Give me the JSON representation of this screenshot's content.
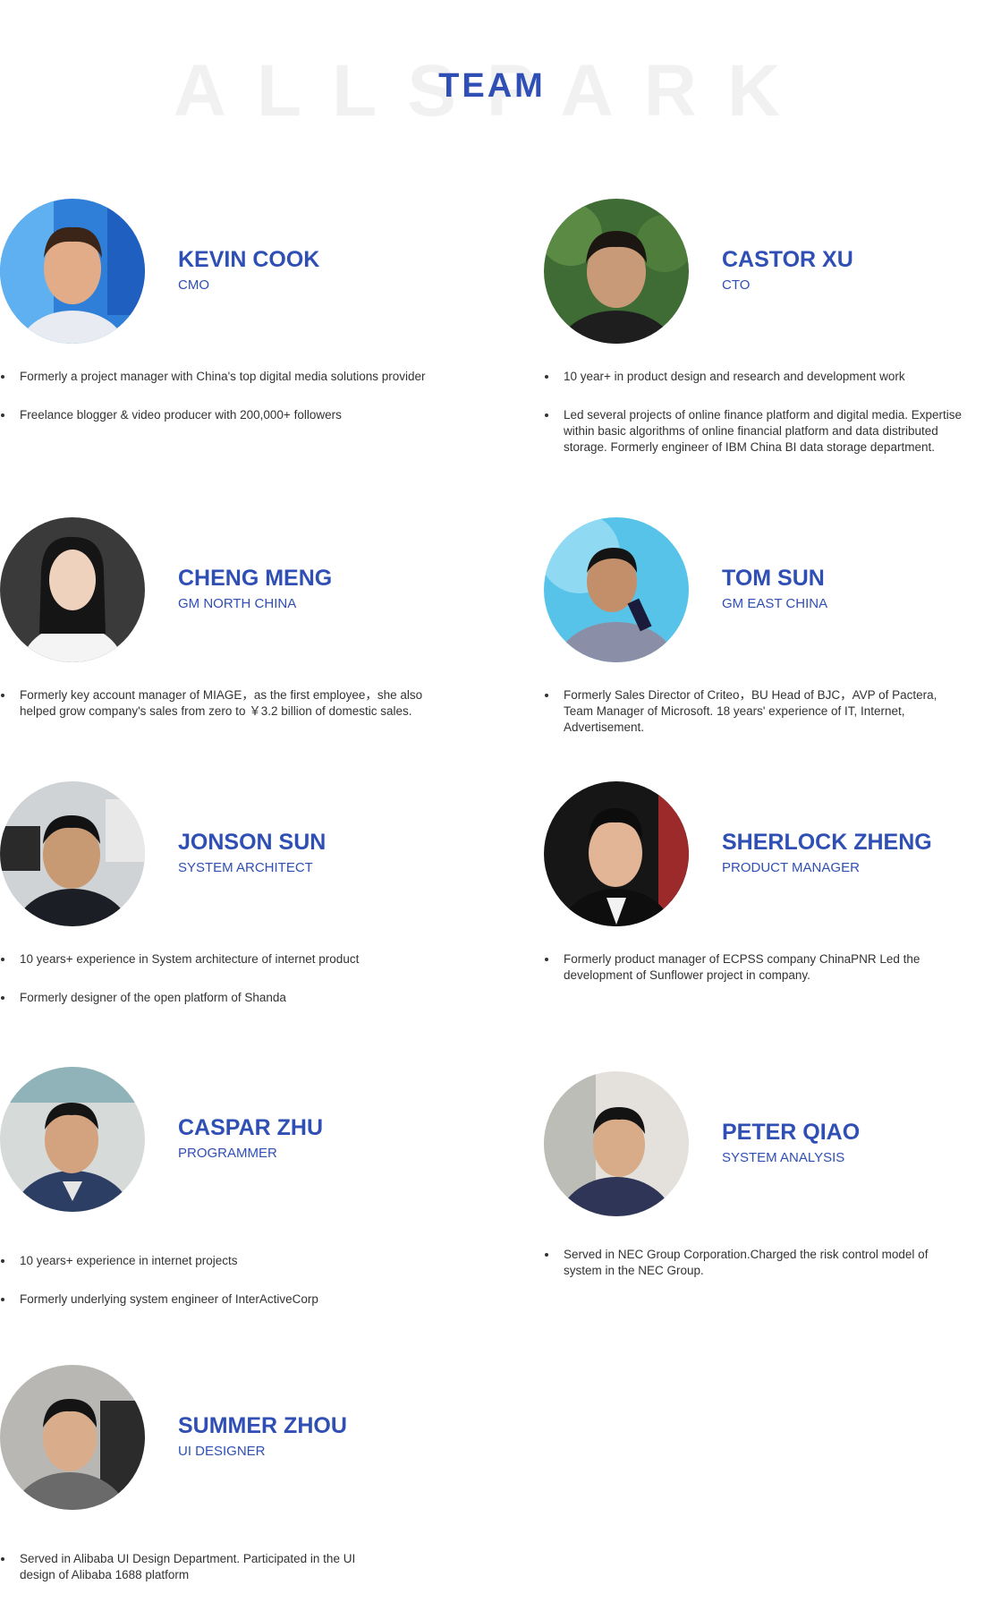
{
  "header": {
    "background_word": "ALLSPARK",
    "title": "TEAM"
  },
  "colors": {
    "accent": "#2f4fb5",
    "text": "#333333"
  },
  "members": [
    {
      "name": "KEVIN COOK",
      "role": "CMO",
      "bullets": [
        "Formerly a project manager with China's top digital media solutions provider",
        "Freelance blogger & video producer with  200,000+ followers"
      ]
    },
    {
      "name": "CASTOR XU",
      "role": "CTO",
      "bullets": [
        "10 year+ in product design and research and development work",
        "Led several projects of online finance platform and digital media. Expertise within basic algorithms of online financial platform and data distributed storage. Formerly engineer of IBM China BI data storage department."
      ]
    },
    {
      "name": "CHENG MENG",
      "role": "GM  NORTH CHINA",
      "bullets": [
        "Formerly key account manager of MIAGE，as the first employee，she also helped grow company's sales from zero to ￥3.2 billion of domestic sales."
      ]
    },
    {
      "name": "TOM SUN",
      "role": "GM  EAST CHINA",
      "bullets": [
        "Formerly Sales Director of Criteo，BU Head of BJC，AVP of Pactera, Team Manager of Microsoft. 18 years' experience of IT, Internet, Advertisement."
      ]
    },
    {
      "name": "JONSON  SUN",
      "role": "SYSTEM ARCHITECT",
      "bullets": [
        "10 years+ experience in System architecture of internet product",
        "Formerly designer of the open platform of Shanda"
      ]
    },
    {
      "name": "SHERLOCK ZHENG",
      "role": "PRODUCT MANAGER",
      "bullets": [
        "Formerly product manager of ECPSS company ChinaPNR Led the development of Sunflower project in company."
      ]
    },
    {
      "name": "CASPAR ZHU",
      "role": "PROGRAMMER",
      "bullets": [
        "10 years+ experience in internet projects",
        "Formerly underlying system engineer of InterActiveCorp"
      ]
    },
    {
      "name": "PETER QIAO",
      "role": "SYSTEM ANALYSIS",
      "bullets": [
        "Served in NEC Group Corporation.Charged the risk control model of system in the NEC Group."
      ]
    },
    {
      "name": "SUMMER ZHOU",
      "role": "UI DESIGNER",
      "bullets": [
        "Served in Alibaba UI Design Department. Participated in the UI design of Alibaba 1688 platform"
      ]
    }
  ]
}
